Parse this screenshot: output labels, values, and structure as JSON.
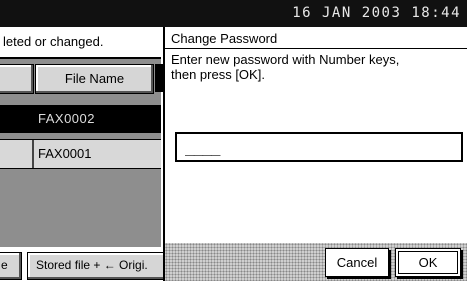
{
  "header": {
    "datetime": "16 JAN   2003 18:44"
  },
  "left_panel": {
    "status_text": "leted or changed.",
    "column_header": "File Name",
    "rows": [
      {
        "name": "FAX0002",
        "selected": true
      },
      {
        "name": "FAX0001",
        "selected": false
      }
    ],
    "bottom_stub_label": "e",
    "stored_file_button": "Stored file + ← Origi."
  },
  "dialog": {
    "title": "Change Password",
    "message_line1": "Enter new password with Number keys,",
    "message_line2": "then press [OK].",
    "password_value": "____",
    "cancel_label": "Cancel",
    "ok_label": "OK"
  }
}
